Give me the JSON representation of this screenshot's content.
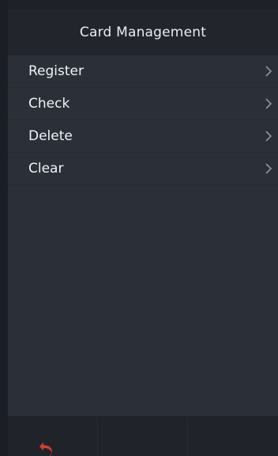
{
  "header": {
    "title": "Card Management"
  },
  "menu": {
    "items": [
      {
        "label": "Register",
        "icon": "chevron-right-icon"
      },
      {
        "label": "Check",
        "icon": "chevron-right-icon"
      },
      {
        "label": "Delete",
        "icon": "chevron-right-icon"
      },
      {
        "label": "Clear",
        "icon": "chevron-right-icon"
      }
    ]
  },
  "bottom_bar": {
    "back_icon": "return-arrow-icon",
    "back_color": "#e23b2e"
  },
  "colors": {
    "background": "#2b3038",
    "header": "#22262c",
    "text": "#f0f3f6",
    "chevron": "#8f949b"
  }
}
